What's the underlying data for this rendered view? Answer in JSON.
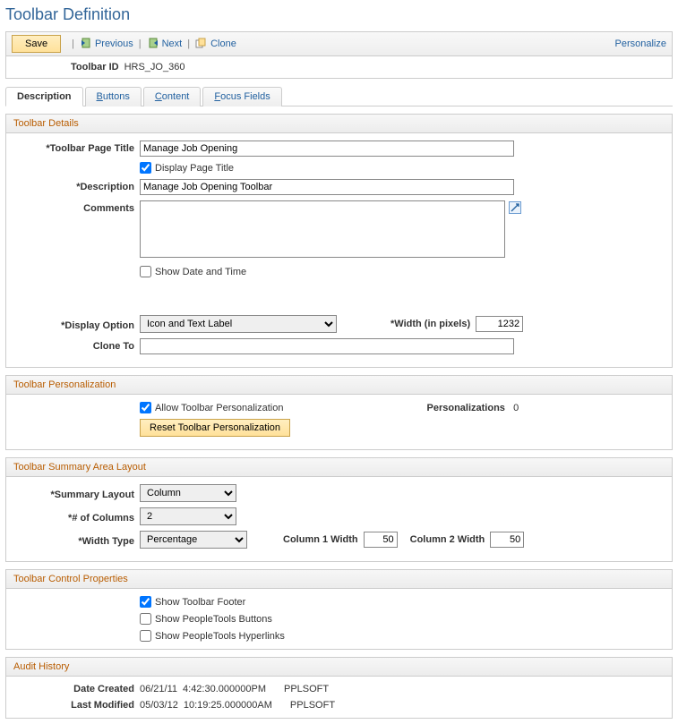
{
  "page": {
    "title": "Toolbar Definition"
  },
  "toolbar": {
    "save_label": "Save",
    "previous_label": "Previous",
    "next_label": "Next",
    "clone_label": "Clone",
    "personalize_label": "Personalize"
  },
  "identity": {
    "id_label": "Toolbar ID",
    "id_value": "HRS_JO_360"
  },
  "tabs": {
    "description": "Description",
    "buttons": "uttons",
    "content": "ontent",
    "focus": "ocus Fields"
  },
  "details": {
    "header": "Toolbar Details",
    "page_title_label": "*Toolbar Page Title",
    "page_title_value": "Manage Job Opening",
    "display_title_label": "Display Page Title",
    "description_label": "*Description",
    "description_value": "Manage Job Opening Toolbar",
    "comments_label": "Comments",
    "comments_value": "",
    "show_datetime_label": "Show Date and Time",
    "display_option_label": "*Display Option",
    "display_option_value": "Icon and Text Label",
    "width_label": "*Width (in pixels)",
    "width_value": "1232",
    "clone_to_label": "Clone To",
    "clone_to_value": ""
  },
  "personalization": {
    "header": "Toolbar Personalization",
    "allow_label": "Allow Toolbar Personalization",
    "reset_label": "Reset Toolbar Personalization",
    "count_label": "Personalizations",
    "count_value": "0"
  },
  "summary": {
    "header": "Toolbar Summary Area Layout",
    "layout_label": "*Summary Layout",
    "layout_value": "Column",
    "cols_label": "*# of Columns",
    "cols_value": "2",
    "width_type_label": "*Width Type",
    "width_type_value": "Percentage",
    "col1_label": "Column 1 Width",
    "col1_value": "50",
    "col2_label": "Column 2 Width",
    "col2_value": "50"
  },
  "control": {
    "header": "Toolbar Control Properties",
    "footer_label": "Show Toolbar Footer",
    "pt_buttons_label": "Show PeopleTools Buttons",
    "pt_links_label": "Show PeopleTools Hyperlinks"
  },
  "audit": {
    "header": "Audit History",
    "created_label": "Date Created",
    "created_date": "06/21/11",
    "created_time": "4:42:30.000000PM",
    "created_user": "PPLSOFT",
    "modified_label": "Last Modified",
    "modified_date": "05/03/12",
    "modified_time": "10:19:25.000000AM",
    "modified_user": "PPLSOFT"
  }
}
